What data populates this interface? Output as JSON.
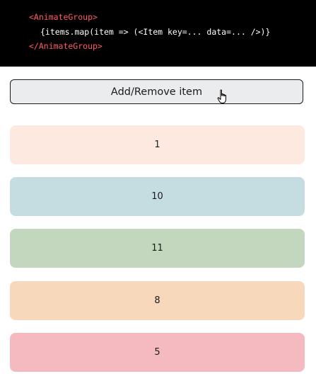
{
  "code": {
    "open_tag": "<AnimateGroup>",
    "expression": "{items.map(item => (<Item key=... data=... />)}",
    "close_tag": "</AnimateGroup>",
    "tag_color": "#ff5a64",
    "text_color": "#ffffff",
    "background": "#000000"
  },
  "button": {
    "label": "Add/Remove item"
  },
  "cursor": {
    "icon": "hand-pointer-icon"
  },
  "items": [
    {
      "label": "1",
      "color": "#fde9e0"
    },
    {
      "label": "10",
      "color": "#c5dce1"
    },
    {
      "label": "11",
      "color": "#c3d7bf"
    },
    {
      "label": "8",
      "color": "#f8d8bb"
    },
    {
      "label": "5",
      "color": "#f4babf"
    }
  ]
}
